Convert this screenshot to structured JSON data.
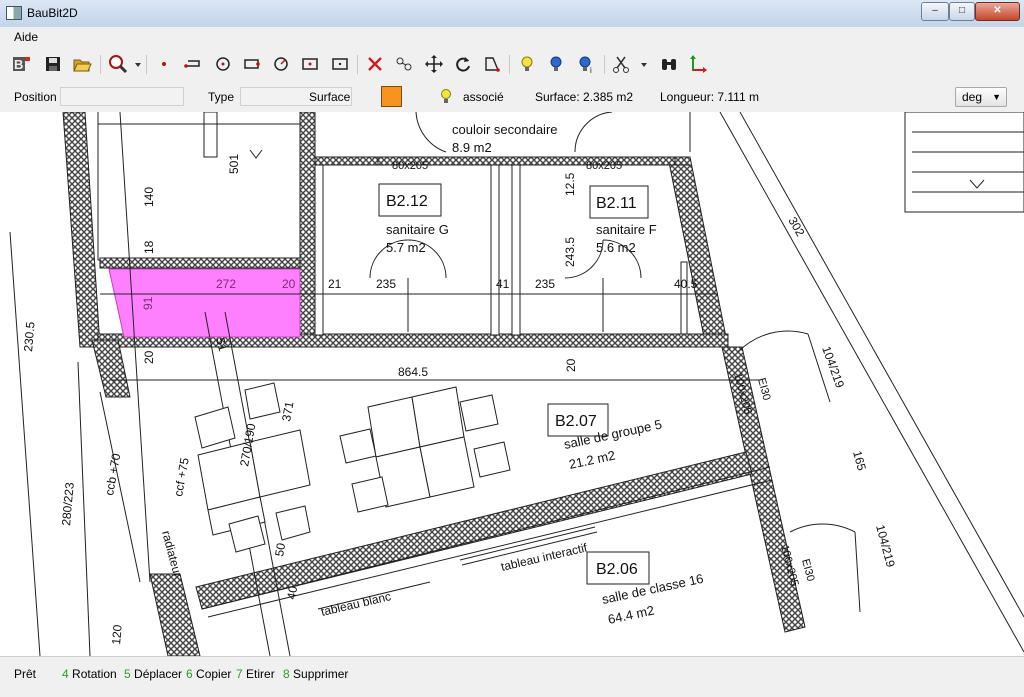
{
  "window": {
    "title": "BauBit2D",
    "minimize": "–",
    "maximize": "□",
    "close": "✕"
  },
  "menu": {
    "items": [
      "Aide"
    ]
  },
  "toolbar": {
    "icons": [
      "logo-icon",
      "save-icon",
      "open-icon",
      "zoom-icon",
      "dropdown-arrow-icon",
      "point-icon",
      "line-icon",
      "circle-icon",
      "rectangle-icon",
      "arc-icon",
      "box-icon",
      "box-point-icon",
      "delete-icon",
      "node-icon",
      "move-icon",
      "rotate-icon",
      "shape-icon",
      "bulb-yellow-icon",
      "bulb-blue-icon",
      "bulb-info-icon",
      "scissors-icon",
      "dropdown-arrow-icon",
      "binoculars-icon",
      "axes-icon"
    ]
  },
  "properties": {
    "position_label": "Position",
    "position_value": "",
    "type_label": "Type",
    "type_value": "",
    "surface_label": "Surface",
    "swatch_color": "#f7931e",
    "associe_label": "associé",
    "surface_text": "Surface:  2.385  m2",
    "longueur_text": "Longueur:  7.111  m",
    "unit": "deg"
  },
  "plan": {
    "rooms": [
      {
        "id": "B2.12",
        "name": "sanitaire G",
        "area": "5.7 m2"
      },
      {
        "id": "B2.11",
        "name": "sanitaire F",
        "area": "5.6 m2"
      },
      {
        "id": "B2.07",
        "name": "salle de groupe 5",
        "area": "21.2 m2"
      },
      {
        "id": "B2.06",
        "name": "salle de classe 16",
        "area": "64.4 m2"
      }
    ],
    "corridor": {
      "name": "couloir secondaire",
      "area": "8.9 m2"
    },
    "labels": [
      "501",
      "140",
      "18",
      "91",
      "272",
      "20",
      "21",
      "235",
      "41",
      "235",
      "40.5",
      "12.5",
      "243.5",
      "80x205",
      "80x205",
      "864.5",
      "20",
      "20",
      "230.5",
      "302",
      "104/219",
      "165",
      "104/219",
      "100x205",
      "EI30",
      "100x205",
      "EI30",
      "371",
      "270/190",
      "ccf +75",
      "radiateur",
      "ccb +70",
      "280/223",
      "51",
      "50",
      "40",
      "120",
      "tableau interactif",
      "tableau blanc"
    ]
  },
  "status": {
    "ready": "Prêt",
    "shortcuts": [
      {
        "key": "4",
        "label": "Rotation"
      },
      {
        "key": "5",
        "label": "Déplacer"
      },
      {
        "key": "6",
        "label": "Copier"
      },
      {
        "key": "7",
        "label": "Etirer"
      },
      {
        "key": "8",
        "label": "Supprimer"
      }
    ]
  },
  "colors": {
    "selection": "#ff80ff",
    "accent_orange": "#f7931e",
    "shortcut_green": "#2e9a2e"
  }
}
